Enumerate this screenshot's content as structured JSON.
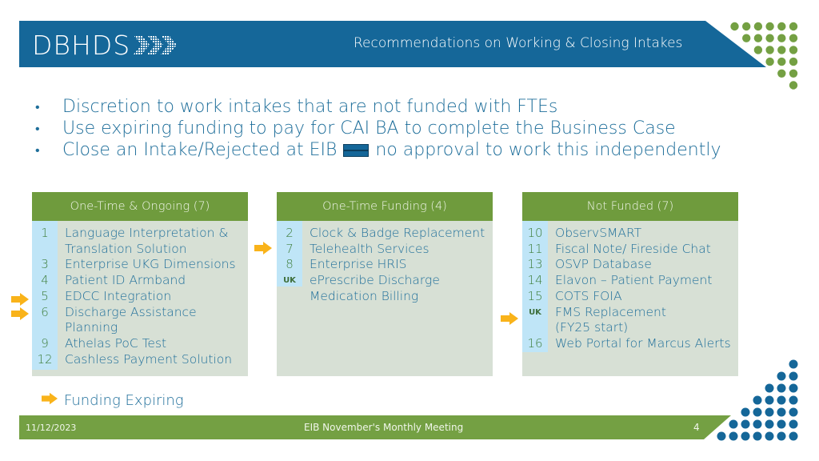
{
  "header": {
    "logo_text": "DBHDS",
    "title": "Recommendations on Working & Closing Intakes"
  },
  "bullets": [
    {
      "text": "Discretion to work intakes that are not funded with FTEs"
    },
    {
      "text": "Use expiring funding to pay for CAI BA to complete the Business Case"
    },
    {
      "text_before": "Close an Intake/Rejected at EIB",
      "icon": "equals-icon",
      "text_after": "no approval to work this independently"
    }
  ],
  "panels": [
    {
      "title": "One-Time & Ongoing (7)",
      "rows": [
        {
          "num": "1",
          "text": "Language Interpretation &"
        },
        {
          "num": "",
          "text": "Translation Solution"
        },
        {
          "num": "3",
          "text": "Enterprise UKG Dimensions"
        },
        {
          "num": "4",
          "text": "Patient ID Armband"
        },
        {
          "num": "5",
          "text": "EDCC Integration",
          "expiring": true
        },
        {
          "num": "6",
          "text": "Discharge Assistance",
          "expiring": true
        },
        {
          "num": "",
          "text": "Planning"
        },
        {
          "num": "9",
          "text": "Athelas PoC Test"
        },
        {
          "num": "12",
          "text": "Cashless Payment Solution"
        }
      ]
    },
    {
      "title": "One-Time Funding (4)",
      "rows": [
        {
          "num": "2",
          "text": "Clock & Badge Replacement"
        },
        {
          "num": "7",
          "text": "Telehealth Services",
          "expiring": true
        },
        {
          "num": "8",
          "text": "Enterprise HRIS"
        },
        {
          "num": "UK",
          "text": "ePrescribe Discharge"
        },
        {
          "num": "",
          "text": "Medication Billing"
        }
      ]
    },
    {
      "title": "Not Funded (7)",
      "rows": [
        {
          "num": "10",
          "text": "ObservSMART"
        },
        {
          "num": "11",
          "text": "Fiscal Note/ Fireside Chat"
        },
        {
          "num": "13",
          "text": "OSVP Database"
        },
        {
          "num": "14",
          "text": "Elavon – Patient Payment"
        },
        {
          "num": "15",
          "text": "COTS FOIA"
        },
        {
          "num": "UK",
          "text": "FMS Replacement",
          "expiring": true
        },
        {
          "num": "",
          "text": "(FY25 start)"
        },
        {
          "num": "16",
          "text": "Web Portal for Marcus Alerts"
        }
      ]
    }
  ],
  "legend": {
    "icon": "arrow-right-icon",
    "label": "Funding Expiring"
  },
  "footer": {
    "date": "11/12/2023",
    "title": "EIB November's Monthly Meeting",
    "page": "4"
  },
  "colors": {
    "brand_blue": "#156799",
    "brand_green": "#74a043",
    "panel_bg": "#d7e0d5",
    "number_col_bg": "#bfe5f7",
    "arrow_orange": "#f9b31a",
    "text_blue": "#1e6e9a"
  }
}
